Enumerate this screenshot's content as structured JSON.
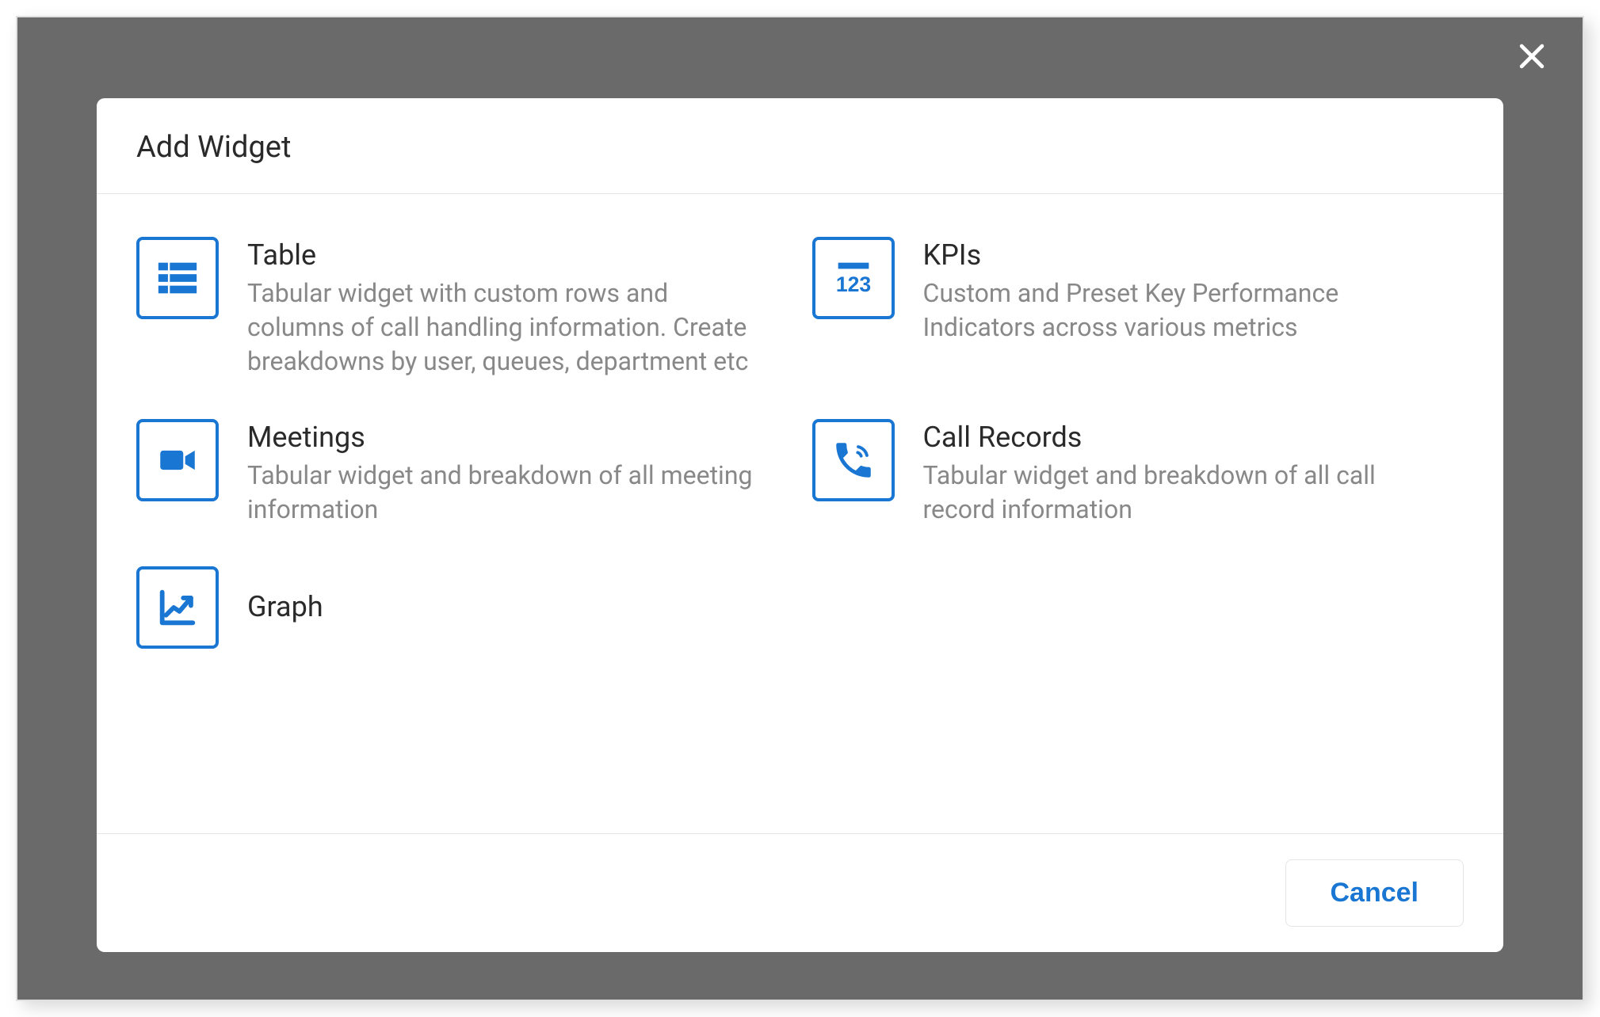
{
  "dialog": {
    "title": "Add Widget",
    "cancel_label": "Cancel"
  },
  "widgets": [
    {
      "key": "table",
      "title": "Table",
      "desc": "Tabular widget with custom rows and columns of call handling information. Create breakdowns by user, queues, department etc"
    },
    {
      "key": "kpis",
      "title": "KPIs",
      "desc": "Custom and Preset Key Performance Indicators across various metrics"
    },
    {
      "key": "meetings",
      "title": "Meetings",
      "desc": "Tabular widget and breakdown of all meeting information"
    },
    {
      "key": "call-records",
      "title": "Call Records",
      "desc": "Tabular widget and breakdown of all call record information"
    },
    {
      "key": "graph",
      "title": "Graph",
      "desc": ""
    }
  ],
  "colors": {
    "accent": "#1976d2",
    "text": "#2a2a2a",
    "muted": "#888"
  }
}
